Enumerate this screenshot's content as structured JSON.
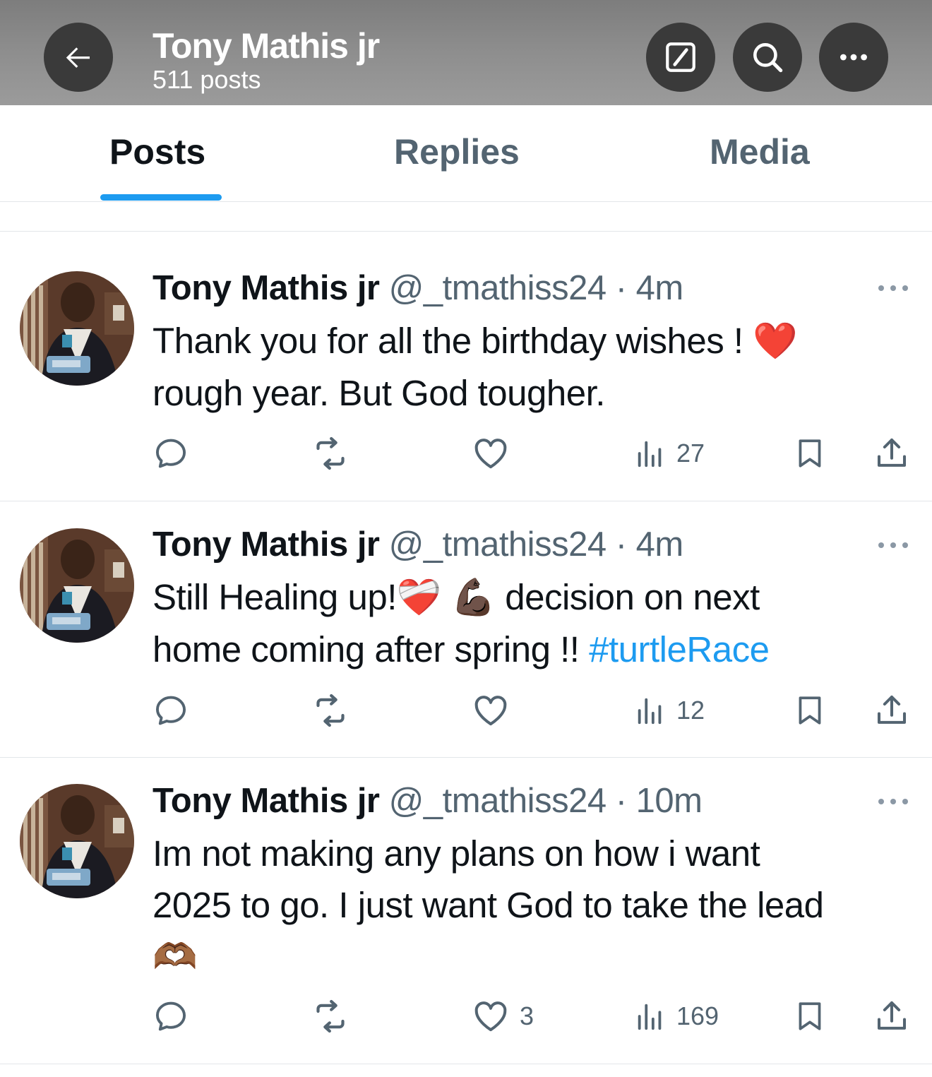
{
  "header": {
    "title": "Tony Mathis jr",
    "subtitle": "511 posts"
  },
  "tabs": [
    {
      "label": "Posts",
      "active": true
    },
    {
      "label": "Replies",
      "active": false
    },
    {
      "label": "Media",
      "active": false
    }
  ],
  "posts": [
    {
      "name": "Tony Mathis jr",
      "handle": "@_tmathiss24",
      "separator": "·",
      "time": "4m",
      "text_line1": "Thank you for all the birthday wishes ! ",
      "emoji1": "❤️",
      "text_line2": "rough year. But God tougher.",
      "likes": "",
      "views": "27"
    },
    {
      "name": "Tony Mathis jr",
      "handle": "@_tmathiss24",
      "separator": "·",
      "time": "4m",
      "text_line1a": "Still Healing up!",
      "emoji1": "❤️‍🩹",
      "emoji2": "💪🏿",
      "text_line1b": " decision on next",
      "text_line2": "home coming after spring !! ",
      "hashtag": "#turtleRace",
      "likes": "",
      "views": "12"
    },
    {
      "name": "Tony Mathis jr",
      "handle": "@_tmathiss24",
      "separator": "·",
      "time": "10m",
      "text_line1": "Im not making any plans on how i want",
      "text_line2": "2025 to go. I just want God to take the lead",
      "emoji1": "🫶🏾",
      "likes": "3",
      "views": "169"
    }
  ],
  "icons": {
    "back": "arrow-left-icon",
    "compose": "compose-icon",
    "search": "search-icon",
    "more": "more-icon",
    "reply": "reply-icon",
    "repost": "repost-icon",
    "like": "heart-icon",
    "views": "views-icon",
    "bookmark": "bookmark-icon",
    "share": "share-icon"
  },
  "colors": {
    "accent": "#1d9bf0",
    "secondary_text": "#536471",
    "primary_text": "#0f1419"
  }
}
